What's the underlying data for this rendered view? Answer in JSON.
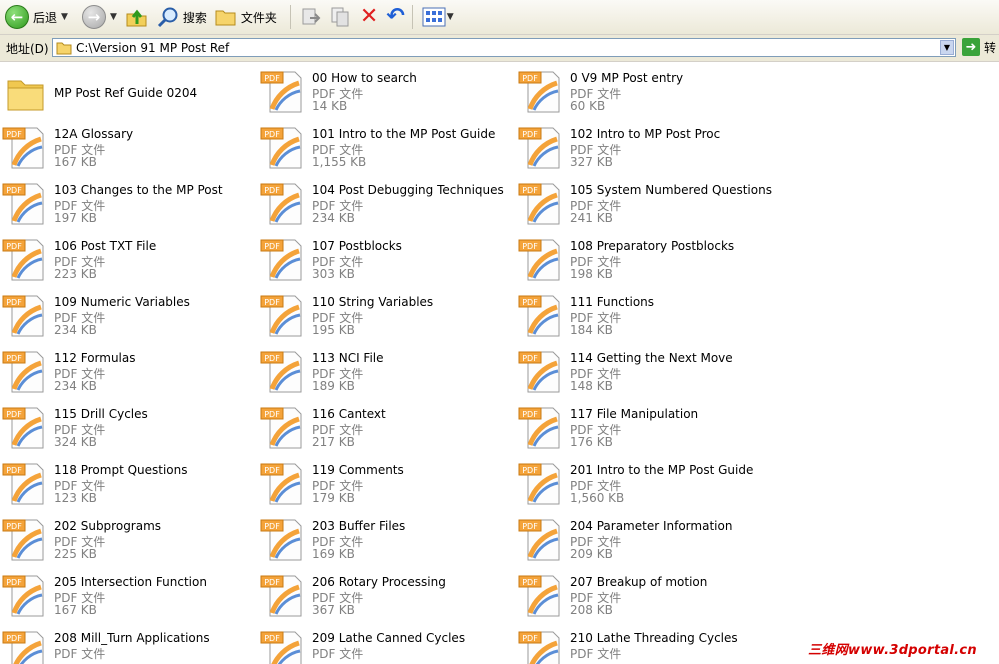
{
  "toolbar": {
    "back_label": "后退",
    "search_label": "搜索",
    "folders_label": "文件夹"
  },
  "address": {
    "label": "地址(D)",
    "path": "C:\\Version 91 MP Post Ref",
    "go_label": "转"
  },
  "folder": {
    "name": "MP Post Ref Guide 0204"
  },
  "files": [
    {
      "name": "00 How to search",
      "type": "PDF 文件",
      "size": "14 KB"
    },
    {
      "name": "0 V9 MP Post entry",
      "type": "PDF 文件",
      "size": "60 KB"
    },
    {
      "name": "12A Glossary",
      "type": "PDF 文件",
      "size": "167 KB"
    },
    {
      "name": "101 Intro to the MP Post Guide",
      "type": "PDF 文件",
      "size": "1,155 KB"
    },
    {
      "name": "102 Intro to MP Post Proc",
      "type": "PDF 文件",
      "size": "327 KB"
    },
    {
      "name": "103 Changes to the MP Post",
      "type": "PDF 文件",
      "size": "197 KB"
    },
    {
      "name": "104 Post Debugging Techniques",
      "type": "PDF 文件",
      "size": "234 KB"
    },
    {
      "name": "105 System Numbered Questions",
      "type": "PDF 文件",
      "size": "241 KB"
    },
    {
      "name": "106 Post TXT File",
      "type": "PDF 文件",
      "size": "223 KB"
    },
    {
      "name": "107 Postblocks",
      "type": "PDF 文件",
      "size": "303 KB"
    },
    {
      "name": "108 Preparatory Postblocks",
      "type": "PDF 文件",
      "size": "198 KB"
    },
    {
      "name": "109 Numeric Variables",
      "type": "PDF 文件",
      "size": "234 KB"
    },
    {
      "name": "110 String Variables",
      "type": "PDF 文件",
      "size": "195 KB"
    },
    {
      "name": "111 Functions",
      "type": "PDF 文件",
      "size": "184 KB"
    },
    {
      "name": "112 Formulas",
      "type": "PDF 文件",
      "size": "234 KB"
    },
    {
      "name": "113 NCI File",
      "type": "PDF 文件",
      "size": "189 KB"
    },
    {
      "name": "114 Getting the Next Move",
      "type": "PDF 文件",
      "size": "148 KB"
    },
    {
      "name": "115 Drill Cycles",
      "type": "PDF 文件",
      "size": "324 KB"
    },
    {
      "name": "116 Cantext",
      "type": "PDF 文件",
      "size": "217 KB"
    },
    {
      "name": "117 File Manipulation",
      "type": "PDF 文件",
      "size": "176 KB"
    },
    {
      "name": "118 Prompt Questions",
      "type": "PDF 文件",
      "size": "123 KB"
    },
    {
      "name": "119 Comments",
      "type": "PDF 文件",
      "size": "179 KB"
    },
    {
      "name": "201 Intro to the MP Post Guide",
      "type": "PDF 文件",
      "size": "1,560 KB"
    },
    {
      "name": "202 Subprograms",
      "type": "PDF 文件",
      "size": "225 KB"
    },
    {
      "name": "203 Buffer Files",
      "type": "PDF 文件",
      "size": "169 KB"
    },
    {
      "name": "204 Parameter Information",
      "type": "PDF 文件",
      "size": "209 KB"
    },
    {
      "name": "205 Intersection Function",
      "type": "PDF 文件",
      "size": "167 KB"
    },
    {
      "name": "206 Rotary Processing",
      "type": "PDF 文件",
      "size": "367 KB"
    },
    {
      "name": "207 Breakup of motion",
      "type": "PDF 文件",
      "size": "208 KB"
    },
    {
      "name": "208 Mill_Turn Applications",
      "type": "PDF 文件",
      "size": ""
    },
    {
      "name": "209 Lathe Canned Cycles",
      "type": "PDF 文件",
      "size": ""
    },
    {
      "name": "210 Lathe Threading Cycles",
      "type": "PDF 文件",
      "size": ""
    }
  ],
  "pdf_badge": "PDF",
  "watermark": "三维网www.3dportal.cn",
  "colors": {
    "accent_red": "#d40000",
    "pdf_orange": "#f4a33a",
    "secondary_text": "#808080"
  }
}
